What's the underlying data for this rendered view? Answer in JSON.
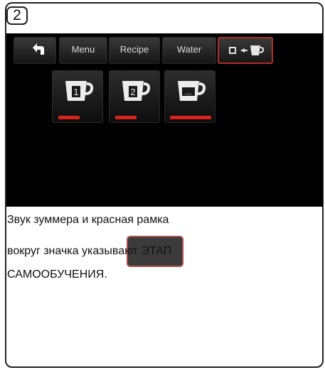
{
  "step": "2",
  "screen": {
    "tabs": {
      "menu": "Menu",
      "recipe": "Recipe",
      "water": "Water"
    },
    "cups": [
      {
        "label": "1"
      },
      {
        "label": "2"
      },
      {
        "label": "..."
      }
    ],
    "colors": {
      "background": "#000000",
      "highlight": "#b03028",
      "indicator": "#d8221c"
    }
  },
  "caption": {
    "line1": "Звук зуммера и красная рамка",
    "line2": "вокруг значка указывают ЭТАП",
    "line3": "САМООБУЧЕНИЯ."
  },
  "icons": [
    "back-arrow-icon",
    "learning-mode-icon",
    "cup-icon"
  ]
}
